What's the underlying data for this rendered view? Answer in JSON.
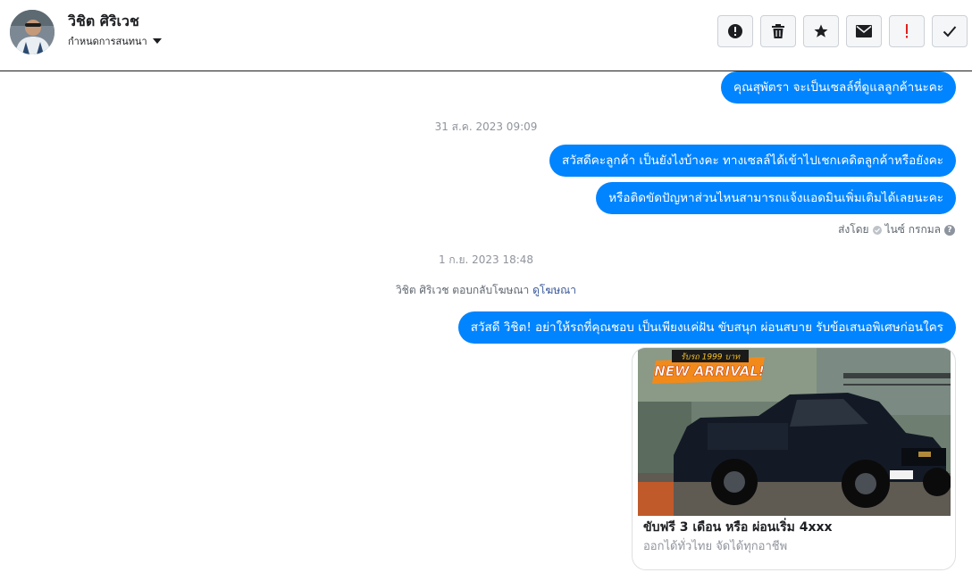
{
  "header": {
    "name": "วิชิต ศิริเวช",
    "subtitle": "กำหนดการสนทนา",
    "avatar_icon": "avatar-person-icon"
  },
  "toolbar": {
    "buttons": [
      {
        "name": "report-spam",
        "icon": "alert-circle-icon"
      },
      {
        "name": "delete",
        "icon": "trash-icon"
      },
      {
        "name": "star",
        "icon": "star-icon"
      },
      {
        "name": "mark-unread",
        "icon": "envelope-icon"
      },
      {
        "name": "follow-up",
        "icon": "exclamation-icon"
      },
      {
        "name": "mark-done",
        "icon": "checkmark-icon"
      }
    ]
  },
  "colors": {
    "bubble": "#0084ff",
    "follow_up_accent": "#e02020",
    "link": "#385898"
  },
  "conversation": {
    "messages_top": [
      {
        "text": "คุณสุพัตรา จะเป็นเซลล์ที่ดูแลลูกค้านะคะ"
      }
    ],
    "timestamp_1": "31 ส.ค. 2023 09:09",
    "messages_mid": [
      {
        "text": "สวัสดีคะลูกค้า เป็นยังไงบ้างคะ ทางเซลล์ได้เข้าไปเชกเคดิตลูกค้าหรือยังคะ"
      },
      {
        "text": "หรือติดขัดปัญหาส่วนไหนสามารถแจ้งแอดมินเพิ่มเติมได้เลยนะคะ"
      }
    ],
    "sent_by_label": "ส่งโดย",
    "sent_by_name": "ไนซ์ กรกมล",
    "help_symbol": "?",
    "timestamp_2": "1 ก.ย. 2023 18:48",
    "reply_note": "วิชิต ศิริเวช ตอบกลับโฆษณา",
    "reply_link": "ดูโฆษณา",
    "ad_message": "สวัสดี วิชิต! อย่าให้รถที่คุณชอบ เป็นเพียงแค่ฝัน ขับสนุก ผ่อนสบาย รับข้อเสนอพิเศษก่อนใคร",
    "ad_card": {
      "banner_small": "รับรถ 1999 บาท",
      "banner_big": "NEW ARRIVAL!",
      "title": "ขับฟรี 3 เดือน หรือ ผ่อนเริ่ม 4xxx",
      "subtitle": "ออกได้ทั่วไทย จัดได้ทุกอาชีพ"
    }
  }
}
